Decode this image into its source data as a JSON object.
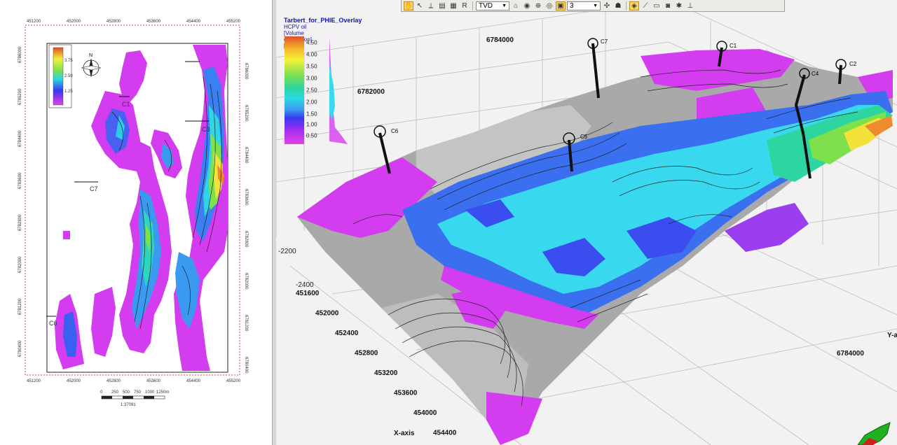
{
  "toolbar": {
    "view_mode": "TVD",
    "vertical_exaggeration": "3",
    "buttons": [
      "hand-icon",
      "pointer-icon",
      "ruler-icon",
      "layer-icon",
      "print-icon",
      "rr-icon",
      "home-icon",
      "eye-icon",
      "zoom-icon",
      "target-icon",
      "anchor-icon",
      "measure-icon",
      "capture-icon",
      "camera-icon",
      "settings-icon",
      "pin-icon"
    ]
  },
  "legend": {
    "title": "Tarbert_for_PHIE_Overlay",
    "subtitle": "HCPV oil [Volume calculation] [m]",
    "ticks": [
      "4.50",
      "4.00",
      "3.50",
      "3.00",
      "2.50",
      "2.00",
      "1.50",
      "1.00",
      "0.50"
    ]
  },
  "map2d": {
    "x_ticks": [
      "451200",
      "452000",
      "452800",
      "453600",
      "454400",
      "455200"
    ],
    "y_ticks_left": [
      "6786000",
      "6785200",
      "6784400",
      "6783600",
      "6782800",
      "6782000",
      "6781200",
      "6780400"
    ],
    "y_ticks_right": [
      "6786000",
      "6785200",
      "6784400",
      "6783600",
      "6782800",
      "6782000",
      "6781200",
      "6780400"
    ],
    "legend_ticks": [
      "3.75",
      "2.50",
      "1.25"
    ],
    "wells": [
      "C1",
      "C3",
      "C7",
      "C6"
    ],
    "scalebar_labels": [
      "0",
      "250",
      "500",
      "750",
      "1000",
      "1250m"
    ],
    "scale_text": "1:37091",
    "north": "N"
  },
  "view3d": {
    "wells": [
      "C7",
      "C1",
      "C4",
      "C2",
      "C6",
      "C5"
    ],
    "y_axis_top": [
      "6784000",
      "6782000"
    ],
    "y_axis_right": "6784000",
    "y_axis_letter": "Y-a",
    "z_ticks": [
      "-2200",
      "-2400"
    ],
    "x_ticks": [
      "451600",
      "452000",
      "452400",
      "452800",
      "453200",
      "453600",
      "454000",
      "454400"
    ],
    "x_axis_label": "X-axis"
  },
  "colors": {
    "surface_grey": "#a8a8a8",
    "magenta": "#d23cf0",
    "cyan": "#38d8ee",
    "blue": "#3a4ef0",
    "green": "#7ee04a",
    "orange": "#f08a30",
    "legend_text": "#1414b4"
  }
}
